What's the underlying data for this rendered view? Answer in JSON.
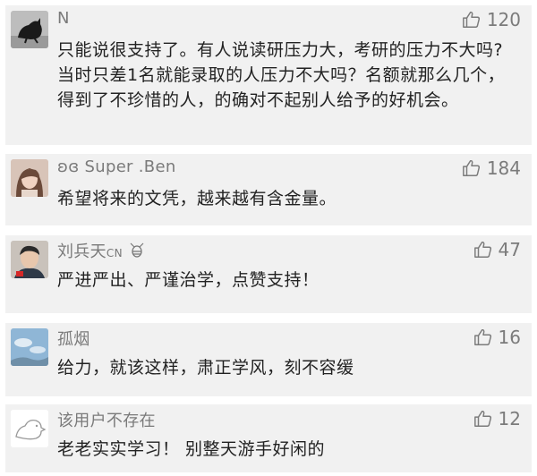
{
  "comments": [
    {
      "name": "N",
      "likes": "120",
      "text": "只能说很支持了。有人说读研压力大，考研的压力不大吗?当时只差1名就能录取的人压力不大吗？名额就那么几个，得到了不珍惜的人，的确对不起别人给予的好机会。",
      "avatar_icon": "black-cat-avatar"
    },
    {
      "name": "ʚɞ Super .Ben",
      "likes": "184",
      "text": "希望将来的文凭，越来越有含金量。",
      "avatar_icon": "girl-portrait-avatar"
    },
    {
      "name": "刘兵天",
      "name_badge": "CN",
      "likes": "47",
      "text": "严进严出、严谨治学，点赞支持！",
      "avatar_icon": "man-portrait-avatar"
    },
    {
      "name": "孤烟",
      "likes": "16",
      "text": "给力，就该这样，肃正学风，刻不容缓",
      "avatar_icon": "sky-landscape-avatar"
    },
    {
      "name": "该用户不存在",
      "likes": "12",
      "text": "老老实实学习！ 别整天游手好闲的",
      "avatar_icon": "outline-animal-avatar"
    }
  ],
  "colors": {
    "card_bg": "#f1f1f1",
    "name": "#7a7a7a",
    "text": "#222222",
    "likes": "#7b7b7b"
  },
  "icons": {
    "like": "thumbs-up-icon"
  }
}
